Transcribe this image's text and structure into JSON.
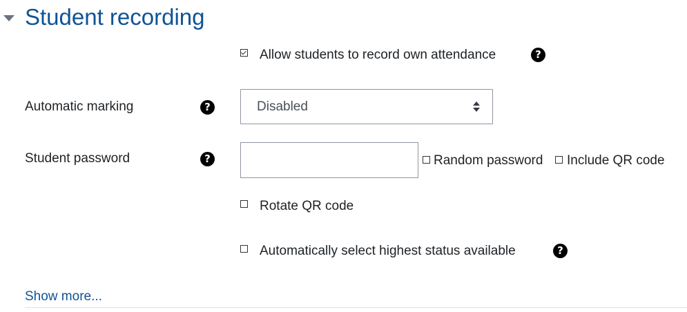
{
  "section": {
    "title": "Student recording"
  },
  "allow_self_record": {
    "label": "Allow students to record own attendance",
    "checked": true
  },
  "automatic_marking": {
    "label": "Automatic marking",
    "selected": "Disabled"
  },
  "student_password": {
    "label": "Student password",
    "value": "",
    "random_password_label": "Random password",
    "include_qr_label": "Include QR code"
  },
  "rotate_qr": {
    "label": "Rotate QR code",
    "checked": false
  },
  "auto_highest_status": {
    "label": "Automatically select highest status available",
    "checked": false
  },
  "footer": {
    "show_more": "Show more..."
  },
  "icons": {
    "help": "question-circle-icon",
    "collapse": "caret-down-icon"
  },
  "colors": {
    "heading": "#0f5396",
    "text": "#1d2125",
    "border": "#8f959e"
  }
}
